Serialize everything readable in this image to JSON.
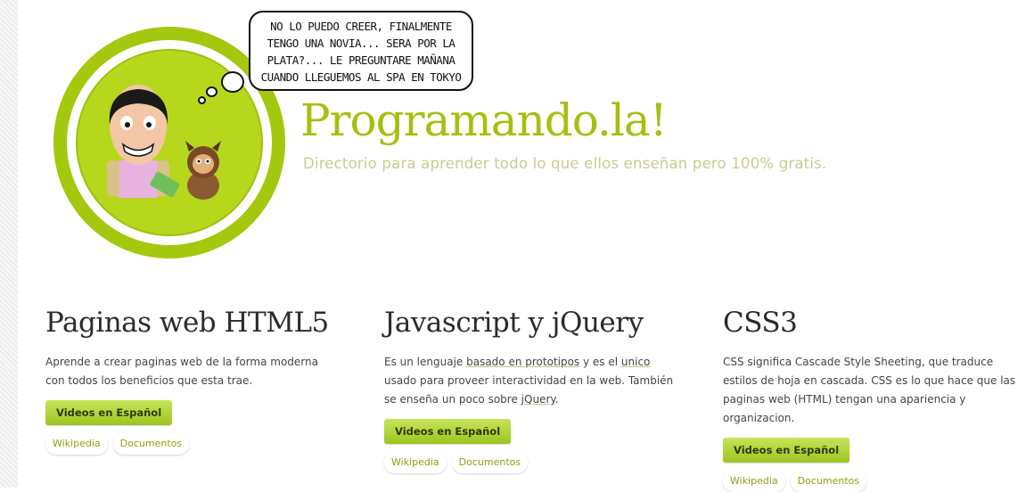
{
  "header": {
    "speech_bubble": "No lo puedo creer, finalmente tengo una novia... Sera por la plata?... Le preguntare mañana cuando lleguemos al spa en Tokyo",
    "title": "Programando.la!",
    "subtitle": "Directorio para aprender todo lo que ellos enseñan pero 100% gratis."
  },
  "sections": [
    {
      "title": "Paginas web HTML5",
      "description": "Aprende a crear paginas web de la forma moderna con todos los beneficios que esta trae.",
      "button": "Videos en Español",
      "link1": "Wikipedia",
      "link2": "Documentos"
    },
    {
      "title": "Javascript y jQuery",
      "desc_1": "Es un lenguaje ",
      "desc_2": "basado en prototipos",
      "desc_3": " y es el ",
      "desc_4": "unico",
      "desc_5": " usado para proveer interactividad en la web. También se enseña un poco sobre ",
      "desc_6": "jQuery",
      "desc_7": ".",
      "button": "Videos en Español",
      "link1": "Wikipedia",
      "link2": "Documentos"
    },
    {
      "title": "CSS3",
      "description": "CSS significa Cascade Style Sheeting, que traduce estilos de hoja en cascada. CSS es lo que hace que las paginas web (HTML) tengan una apariencia y organizacion.",
      "button": "Videos en Español",
      "link1": "Wikipedia",
      "link2": "Documentos"
    }
  ],
  "colors": {
    "accent": "#a4c010",
    "subtitle": "#c2d08c",
    "button": "#9cc520"
  }
}
